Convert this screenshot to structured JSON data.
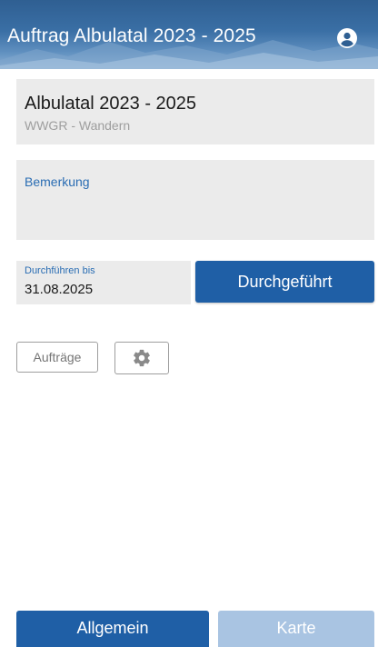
{
  "app_bar": {
    "title": "Auftrag Albulatal 2023 - 2025",
    "account_icon": "account-circle-icon"
  },
  "order": {
    "title": "Albulatal 2023 - 2025",
    "subtitle": "WWGR - Wandern"
  },
  "remark": {
    "label": "Bemerkung",
    "value": ""
  },
  "due": {
    "label": "Durchführen bis",
    "value": "31.08.2025"
  },
  "actions": {
    "done_label": "Durchgeführt",
    "orders_label": "Aufträge",
    "settings_icon": "gear-icon"
  },
  "tabs": [
    {
      "label": "Allgemein",
      "active": true
    },
    {
      "label": "Karte",
      "active": false
    }
  ],
  "colors": {
    "primary": "#1f5fa6",
    "accent_text": "#2a6db3",
    "field_bg": "#ebebeb",
    "tab_inactive": "#a9c4e2"
  }
}
